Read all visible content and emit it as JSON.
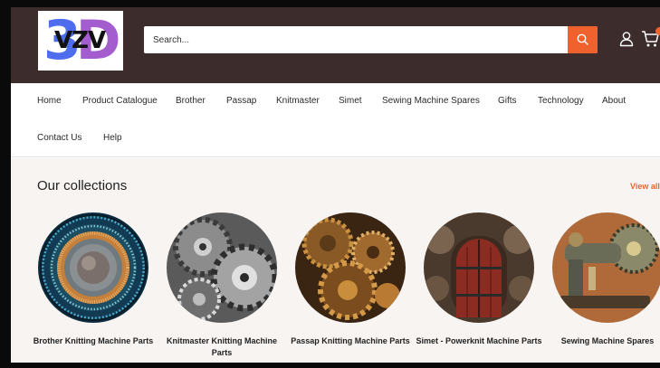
{
  "header": {
    "logo_text": "VZV",
    "logo_mark": "3D",
    "search_placeholder": "Search...",
    "search_icon": "search-icon",
    "user_icon": "user-icon",
    "cart_icon": "cart-icon",
    "accent_color": "#f0622d",
    "header_color": "#3d2c2c"
  },
  "nav": {
    "items": [
      {
        "label": "Home"
      },
      {
        "label": "Product Catalogue"
      },
      {
        "label": "Brother"
      },
      {
        "label": "Passap"
      },
      {
        "label": "Knitmaster"
      },
      {
        "label": "Simet"
      },
      {
        "label": "Sewing Machine Spares"
      },
      {
        "label": "Gifts"
      },
      {
        "label": "Technology"
      },
      {
        "label": "About"
      },
      {
        "label": "Contact Us"
      },
      {
        "label": "Help"
      }
    ]
  },
  "collections": {
    "title": "Our collections",
    "view_all": "View all",
    "items": [
      {
        "label": "Brother Knitting Machine Parts"
      },
      {
        "label": "Knitmaster Knitting Machine Parts"
      },
      {
        "label": "Passap Knitting Machine Parts"
      },
      {
        "label": "Simet - Powerknit Machine Parts"
      },
      {
        "label": "Sewing Machine Spares"
      }
    ]
  }
}
